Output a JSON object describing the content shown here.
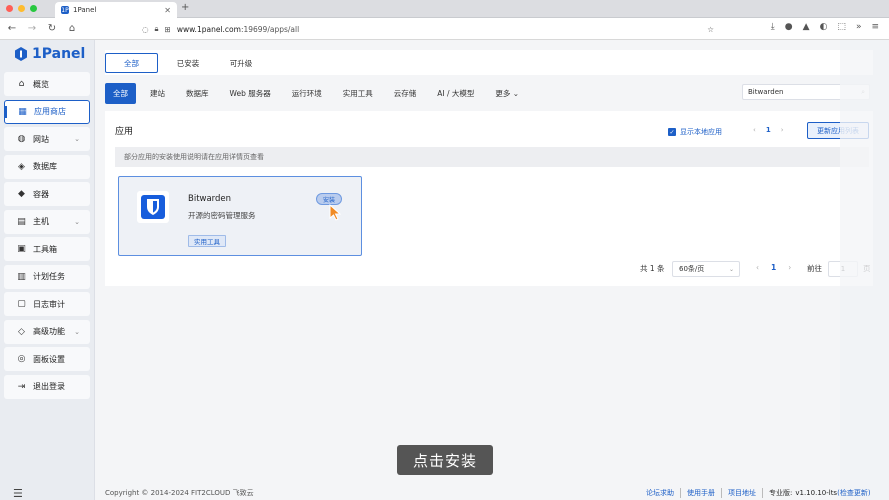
{
  "browser": {
    "tab_title": "1Panel",
    "tab_favicon": "1P",
    "url_host": "www.1panel.com",
    "url_path": ":19699/apps/all"
  },
  "sidebar": {
    "logo": "1Panel",
    "items": [
      {
        "label": "概览",
        "icon": "home-icon",
        "glyph": "⌂"
      },
      {
        "label": "应用商店",
        "icon": "grid-icon",
        "glyph": "▦"
      },
      {
        "label": "网站",
        "icon": "globe-icon",
        "glyph": "◍"
      },
      {
        "label": "数据库",
        "icon": "database-icon",
        "glyph": "◈"
      },
      {
        "label": "容器",
        "icon": "container-icon",
        "glyph": "◆"
      },
      {
        "label": "主机",
        "icon": "host-icon",
        "glyph": "▤"
      },
      {
        "label": "工具箱",
        "icon": "toolbox-icon",
        "glyph": "▣"
      },
      {
        "label": "计划任务",
        "icon": "schedule-icon",
        "glyph": "▥"
      },
      {
        "label": "日志审计",
        "icon": "log-icon",
        "glyph": "▢"
      },
      {
        "label": "高级功能",
        "icon": "diamond-icon",
        "glyph": "◇"
      },
      {
        "label": "面板设置",
        "icon": "settings-icon",
        "glyph": "◎"
      },
      {
        "label": "退出登录",
        "icon": "logout-icon",
        "glyph": "⇥"
      }
    ]
  },
  "filter_tabs": [
    "全部",
    "已安装",
    "可升级"
  ],
  "categories": [
    "全部",
    "建站",
    "数据库",
    "Web 服务器",
    "运行环境",
    "实用工具",
    "云存储",
    "AI / 大模型",
    "更多"
  ],
  "search": {
    "value": "Bitwarden"
  },
  "panel": {
    "title": "应用",
    "show_local": "显示本地应用",
    "page": "1",
    "update_btn": "更新应用列表",
    "notice": "部分应用的安装使用说明请在应用详情页查看"
  },
  "app": {
    "name": "Bitwarden",
    "desc": "开源的密码管理服务",
    "tag": "实用工具",
    "install": "安装"
  },
  "pagination": {
    "total": "共 1 条",
    "per_page": "60条/页",
    "current": "1",
    "goto_label": "前往",
    "goto_value": "1",
    "page_unit": "页"
  },
  "caption": "点击安装",
  "footer": {
    "copyright": "Copyright © 2014-2024 FIT2CLOUD 飞致云",
    "links": [
      "论坛求助",
      "使用手册",
      "项目地址"
    ],
    "edition": "专业版:",
    "version": "v1.10.10-lts",
    "check_update": "(检查更新)"
  }
}
